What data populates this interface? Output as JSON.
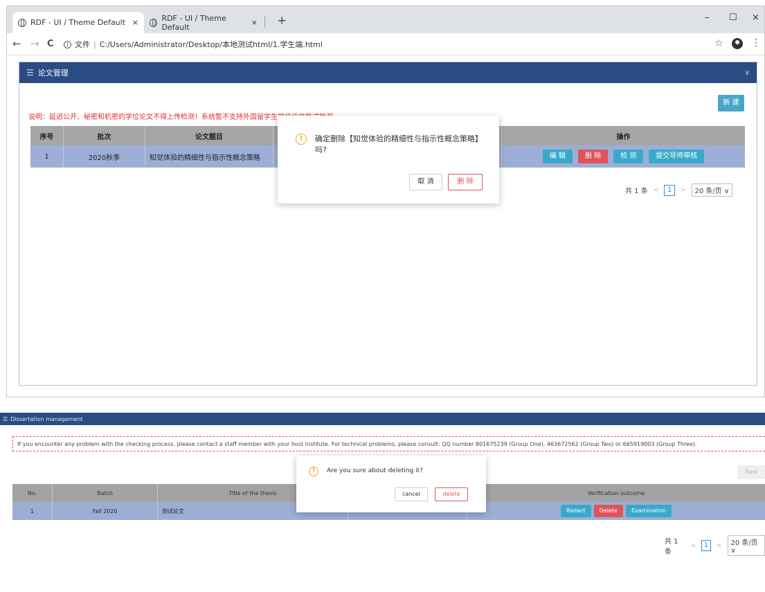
{
  "browser": {
    "tabs": [
      {
        "title": "RDF - UI / Theme Default",
        "close": "×"
      },
      {
        "title": "RDF - UI / Theme Default",
        "close": "×"
      }
    ],
    "new_tab": "+",
    "window_controls": {
      "minimize": "–",
      "maximize": "☐",
      "close": "×"
    },
    "nav": {
      "back": "←",
      "forward": "→",
      "reload": "C"
    },
    "address": {
      "info": "i",
      "label": "文件",
      "url": "C:/Users/Administrator/Desktop/本地测试html/1.学生端.html"
    },
    "star": "☆",
    "kebab": "⋮"
  },
  "top_app": {
    "panel_title": "论文管理",
    "notice": "说明：延迟公开、秘密和机密的学位论文不得上传检测！系统暂不支持外国留学生学位论文格式检测。",
    "new_button": "新 建",
    "table": {
      "headers": [
        "序号",
        "批次",
        "论文题目",
        "",
        "操作"
      ],
      "row": {
        "index": "1",
        "batch": "2020秋季",
        "title": "知觉体验的精细性与指示性概念策略"
      },
      "actions": [
        "编 辑",
        "删 除",
        "检 测",
        "提交导师审核"
      ]
    },
    "pager": {
      "total": "共 1 条",
      "prev": "<",
      "page": "1",
      "next": ">",
      "size": "20 条/页 ∨"
    },
    "dialog": {
      "icon": "!",
      "message": "确定删除【知觉体验的精细性与指示性概念策略】吗?",
      "cancel": "取 消",
      "delete": "删 除"
    }
  },
  "bottom_app": {
    "panel_title": "Dissertation management",
    "notice": "If you encounter any problem with the checking process, please contact a staff member with your host institute. For technical problems, please consult: QQ number 801675239 (Group One), 463672562 (Group Two) or 665919003 (Group Three).",
    "new_button": "New",
    "table": {
      "headers": [
        "No.",
        "Batch",
        "Title of the thesis",
        "",
        "Verification outcome"
      ],
      "row": {
        "index": "1",
        "batch": "Fall 2020",
        "title": "测试论文"
      },
      "actions": [
        "Redact",
        "Delete",
        "Examination"
      ]
    },
    "pager": {
      "total": "共 1 条",
      "prev": "<",
      "page": "1",
      "next": ">",
      "size": "20 条/页 ∨"
    },
    "dialog": {
      "icon": "!",
      "message": "Are you sure about deleting it?",
      "cancel": "cancel",
      "delete": "delete"
    }
  },
  "colors": {
    "header_blue": "#2b4c83",
    "action_blue": "#3aa9c9",
    "danger_red": "#e05358",
    "row_highlight": "#9daed6",
    "warning_orange": "#f2a31b"
  }
}
